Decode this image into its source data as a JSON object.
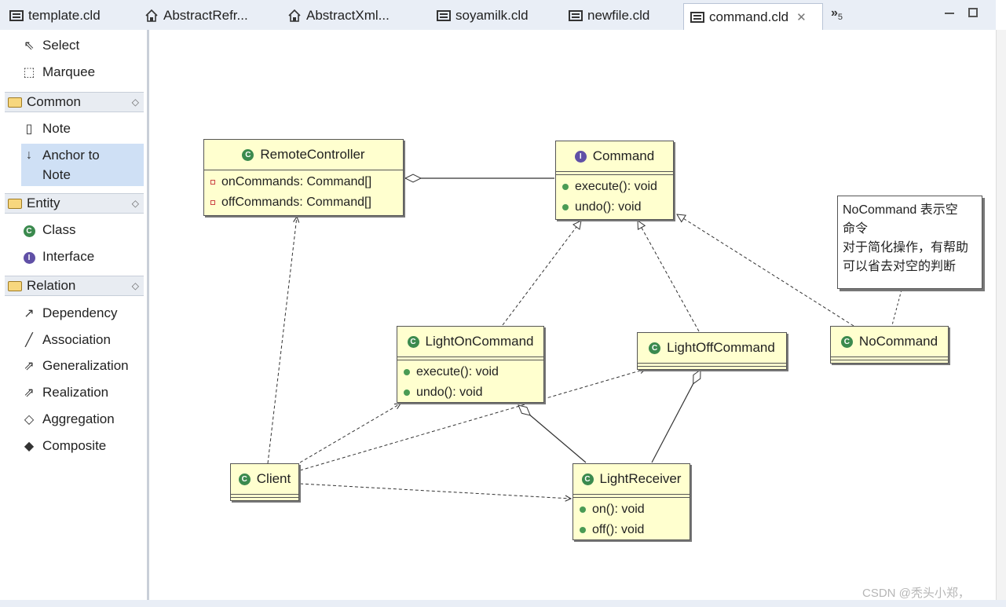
{
  "tabs": [
    {
      "label": "template.cld",
      "icon": "diagram-file-icon"
    },
    {
      "label": "AbstractRefr...",
      "icon": "house-file-icon"
    },
    {
      "label": "AbstractXml...",
      "icon": "house-file-icon"
    },
    {
      "label": "soyamilk.cld",
      "icon": "diagram-file-icon"
    },
    {
      "label": "newfile.cld",
      "icon": "diagram-file-icon"
    },
    {
      "label": "command.cld",
      "icon": "diagram-file-icon",
      "active": true
    }
  ],
  "tab_overflow": "5",
  "palette": {
    "tools": [
      {
        "label": "Select",
        "icon": "arrow-cursor-icon"
      },
      {
        "label": "Marquee",
        "icon": "marquee-icon"
      }
    ],
    "drawers": [
      {
        "label": "Common",
        "items": [
          {
            "label": "Note",
            "icon": "note-icon"
          },
          {
            "label_line1": "Anchor to",
            "label_line2": "Note",
            "icon": "anchor-icon",
            "selected": true
          }
        ]
      },
      {
        "label": "Entity",
        "items": [
          {
            "label": "Class",
            "icon": "class-icon"
          },
          {
            "label": "Interface",
            "icon": "interface-icon"
          }
        ]
      },
      {
        "label": "Relation",
        "items": [
          {
            "label": "Dependency",
            "icon": "dependency-icon"
          },
          {
            "label": "Association",
            "icon": "association-icon"
          },
          {
            "label": "Generalization",
            "icon": "generalization-icon"
          },
          {
            "label": "Realization",
            "icon": "realization-icon"
          },
          {
            "label": "Aggregation",
            "icon": "aggregation-icon"
          },
          {
            "label": "Composite",
            "icon": "composite-icon"
          }
        ]
      }
    ]
  },
  "diagram": {
    "remote_controller": {
      "name": "RemoteController",
      "kind": "class",
      "attrs": [
        "onCommands: Command[]",
        "offCommands: Command[]"
      ]
    },
    "command": {
      "name": "Command",
      "kind": "interface",
      "methods": [
        "execute(): void",
        "undo(): void"
      ]
    },
    "light_on": {
      "name": "LightOnCommand",
      "kind": "class",
      "methods": [
        "execute(): void",
        "undo(): void"
      ]
    },
    "light_off": {
      "name": "LightOffCommand",
      "kind": "class"
    },
    "no_command": {
      "name": "NoCommand",
      "kind": "class"
    },
    "client": {
      "name": "Client",
      "kind": "class"
    },
    "light_receiver": {
      "name": "LightReceiver",
      "kind": "class",
      "methods": [
        "on(): void",
        "off(): void"
      ]
    },
    "note_lines": [
      "NoCommand 表示空",
      "命令",
      "对于简化操作，有帮助",
      "可以省去对空的判断"
    ]
  },
  "watermark": "CSDN @秃头小郑，",
  "colors": {
    "node_fill": "#ffffcf",
    "class_icon": "#3b8a4e",
    "interface_icon": "#6050a6",
    "selection": "#cfe0f5"
  }
}
